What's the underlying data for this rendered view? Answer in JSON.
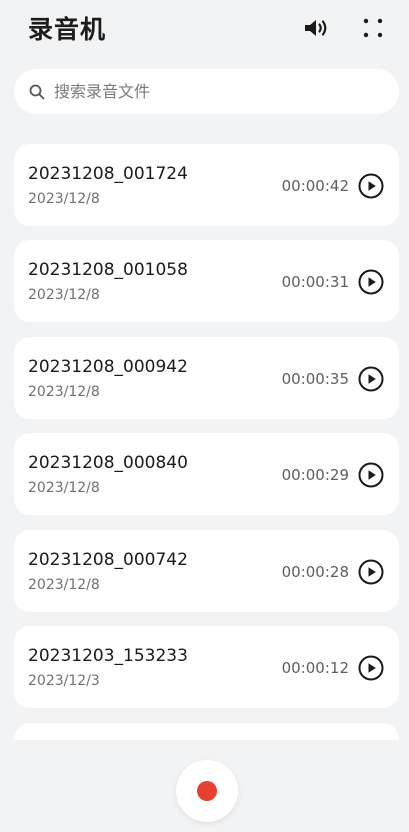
{
  "header": {
    "title": "录音机",
    "speaker_icon": "speaker-icon",
    "more_icon": "more-grid-icon"
  },
  "search": {
    "placeholder": "搜索录音文件",
    "value": ""
  },
  "recordings": [
    {
      "name": "20231208_001724",
      "date": "2023/12/8",
      "duration": "00:00:42"
    },
    {
      "name": "20231208_001058",
      "date": "2023/12/8",
      "duration": "00:00:31"
    },
    {
      "name": "20231208_000942",
      "date": "2023/12/8",
      "duration": "00:00:35"
    },
    {
      "name": "20231208_000840",
      "date": "2023/12/8",
      "duration": "00:00:29"
    },
    {
      "name": "20231208_000742",
      "date": "2023/12/8",
      "duration": "00:00:28"
    },
    {
      "name": "20231203_153233",
      "date": "2023/12/3",
      "duration": "00:00:12"
    }
  ],
  "colors": {
    "background": "#f1f3f5",
    "card": "#ffffff",
    "record_accent": "#e8402f"
  }
}
